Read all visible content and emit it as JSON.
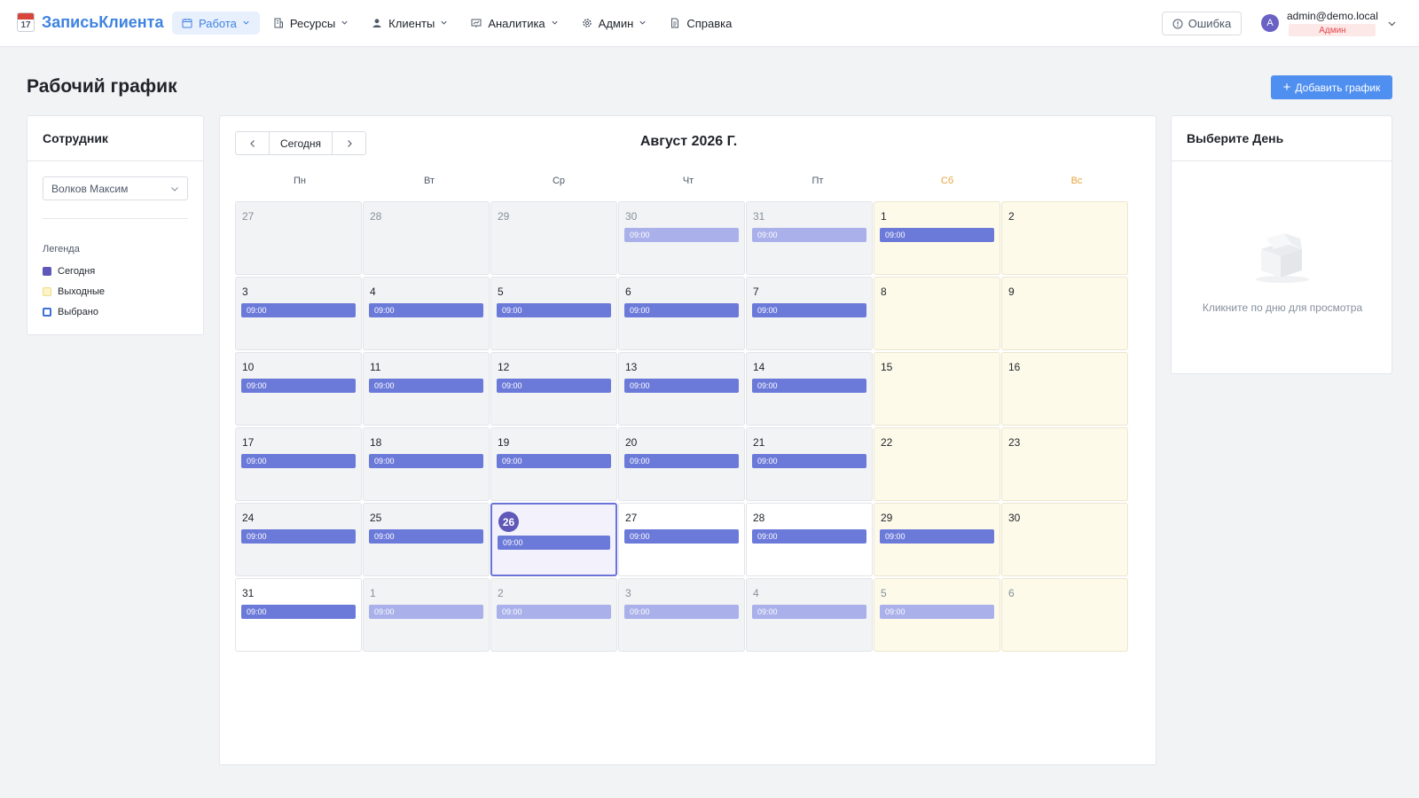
{
  "app": {
    "logo_number": "17",
    "title": "ЗаписьКлиента"
  },
  "nav": [
    {
      "label": "Работа",
      "icon": "calendar-icon",
      "active": true
    },
    {
      "label": "Ресурсы",
      "icon": "building-icon"
    },
    {
      "label": "Клиенты",
      "icon": "user-icon"
    },
    {
      "label": "Аналитика",
      "icon": "chart-icon"
    },
    {
      "label": "Админ",
      "icon": "gear-icon"
    },
    {
      "label": "Справка",
      "icon": "document-icon"
    }
  ],
  "header": {
    "error_label": "Ошибка",
    "user_initial": "A",
    "user_email": "admin@demo.local",
    "user_role": "Админ"
  },
  "page": {
    "title": "Рабочий график",
    "add_button": "Добавить график"
  },
  "employee_panel": {
    "title": "Сотрудник",
    "selected_employee": "Волков Максим",
    "legend_title": "Легенда",
    "legend": [
      {
        "label": "Сегодня",
        "color": "#5f58b8"
      },
      {
        "label": "Выходные",
        "color": "#fdf3c4"
      },
      {
        "label": "Выбрано",
        "color": "#3f6fd8"
      }
    ]
  },
  "calendar": {
    "today_label": "Сегодня",
    "month_title": "Август 2026 Г.",
    "weekdays": [
      "Пн",
      "Вт",
      "Ср",
      "Чт",
      "Пт",
      "Сб",
      "Вс"
    ],
    "weeks": [
      [
        {
          "d": "27",
          "other": true
        },
        {
          "d": "28",
          "other": true
        },
        {
          "d": "29",
          "other": true
        },
        {
          "d": "30",
          "other": true,
          "ev": "09:00"
        },
        {
          "d": "31",
          "other": true,
          "ev": "09:00"
        },
        {
          "d": "1",
          "ev": "09:00"
        },
        {
          "d": "2"
        }
      ],
      [
        {
          "d": "3",
          "ev": "09:00"
        },
        {
          "d": "4",
          "ev": "09:00"
        },
        {
          "d": "5",
          "ev": "09:00"
        },
        {
          "d": "6",
          "ev": "09:00"
        },
        {
          "d": "7",
          "ev": "09:00"
        },
        {
          "d": "8"
        },
        {
          "d": "9"
        }
      ],
      [
        {
          "d": "10",
          "ev": "09:00"
        },
        {
          "d": "11",
          "ev": "09:00"
        },
        {
          "d": "12",
          "ev": "09:00"
        },
        {
          "d": "13",
          "ev": "09:00"
        },
        {
          "d": "14",
          "ev": "09:00"
        },
        {
          "d": "15"
        },
        {
          "d": "16"
        }
      ],
      [
        {
          "d": "17",
          "ev": "09:00"
        },
        {
          "d": "18",
          "ev": "09:00"
        },
        {
          "d": "19",
          "ev": "09:00"
        },
        {
          "d": "20",
          "ev": "09:00"
        },
        {
          "d": "21",
          "ev": "09:00"
        },
        {
          "d": "22"
        },
        {
          "d": "23"
        }
      ],
      [
        {
          "d": "24",
          "ev": "09:00"
        },
        {
          "d": "25",
          "ev": "09:00"
        },
        {
          "d": "26",
          "ev": "09:00",
          "today": true,
          "selected": true
        },
        {
          "d": "27",
          "ev": "09:00",
          "future": true
        },
        {
          "d": "28",
          "ev": "09:00",
          "future": true
        },
        {
          "d": "29",
          "ev": "09:00"
        },
        {
          "d": "30"
        }
      ],
      [
        {
          "d": "31",
          "ev": "09:00",
          "future": true
        },
        {
          "d": "1",
          "other": true,
          "ev": "09:00"
        },
        {
          "d": "2",
          "other": true,
          "ev": "09:00"
        },
        {
          "d": "3",
          "other": true,
          "ev": "09:00"
        },
        {
          "d": "4",
          "other": true,
          "ev": "09:00"
        },
        {
          "d": "5",
          "other": true,
          "ev": "09:00"
        },
        {
          "d": "6",
          "other": true
        }
      ]
    ]
  },
  "day_panel": {
    "title": "Выберите День",
    "empty_text": "Кликните по дню для просмотра"
  }
}
